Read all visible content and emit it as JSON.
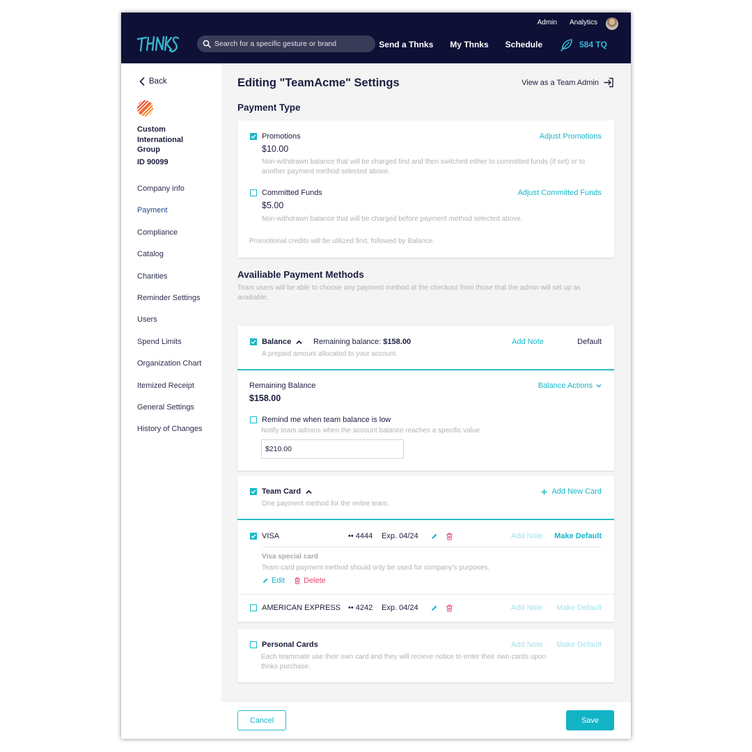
{
  "header": {
    "logo_text": "THNKS",
    "search": {
      "placeholder": "Search for a specific gesture or brand",
      "value": ""
    },
    "top_links": [
      "Admin",
      "Analytics"
    ],
    "main_nav": [
      "Send a Thnks",
      "My Thnks",
      "Schedule"
    ],
    "tq_balance": "584 TQ",
    "colors": {
      "bar": "#0e1036",
      "accent": "#38b8d0"
    }
  },
  "sidebar": {
    "back_label": "Back",
    "company_name": "Custom International Group",
    "company_id": "ID 90099",
    "items": [
      {
        "label": "Company info",
        "active": false
      },
      {
        "label": "Payment",
        "active": true
      },
      {
        "label": "Compliance",
        "active": false
      },
      {
        "label": "Catalog",
        "active": false
      },
      {
        "label": "Charities",
        "active": false
      },
      {
        "label": "Reminder Settings",
        "active": false
      },
      {
        "label": "Users",
        "active": false
      },
      {
        "label": "Spend Limits",
        "active": false
      },
      {
        "label": "Organization Chart",
        "active": false
      },
      {
        "label": "Itemized Receipt",
        "active": false
      },
      {
        "label": "General Settings",
        "active": false
      },
      {
        "label": "History of Changes",
        "active": false
      }
    ]
  },
  "main": {
    "title": "Editing \"TeamAcme\" Settings",
    "view_as_admin": "View as a Team Admin",
    "payment_type": {
      "title": "Payment Type",
      "promotions": {
        "label": "Promotions",
        "checked": true,
        "amount": "$10.00",
        "description": "Non-withdrawn balance that will be charged first and then switched either to committed funds (if set) or to another payment method selected above.",
        "action": "Adjust Promotions"
      },
      "committed": {
        "label": "Committed Funds",
        "checked": false,
        "amount": "$5.00",
        "description": "Non-withdrawn balance that will be charged before payment method selected above.",
        "action": "Adjust Committed Funds"
      },
      "note": "Promotional credits will be utilized first, followed by Balance."
    },
    "methods": {
      "title": "Availiable Payment Methods",
      "subtitle": "Team users will be able to choose any payment method at the checkout from those that the admin will set up as availiable.",
      "balance": {
        "label": "Balance",
        "checked": true,
        "remaining_label": "Remaining balance:",
        "remaining_value": "$158.00",
        "description": "A prepaid amount allocated to your account.",
        "add_note": "Add Note",
        "default_label": "Default",
        "panel": {
          "label": "Remaining Balance",
          "value": "$158.00",
          "actions": "Balance Actions",
          "remind_label": "Remind me when team balance is low",
          "remind_checked": false,
          "remind_desc": "Notify team admins when the account balance reaches a specific value",
          "threshold_value": "$210.00"
        }
      },
      "team_card": {
        "label": "Team Card",
        "checked": true,
        "description": "One payment method for the entire team.",
        "add_card": "Add New Card",
        "cards": [
          {
            "brand": "VISA",
            "checked": true,
            "last4": "•• 4444",
            "expiry": "Exp. 04/24",
            "add_note": "Add Note",
            "make_default": "Make Default",
            "note_title": "Visa special card",
            "note_text": "Team card payment method should only be used for company's purposes.",
            "edit": "Edit",
            "delete": "Delete"
          },
          {
            "brand": "AMERICAN EXPRESS",
            "checked": false,
            "last4": "•• 4242",
            "expiry": "Exp. 04/24",
            "add_note": "Add Note",
            "make_default": "Make Default"
          }
        ]
      },
      "personal": {
        "label": "Personal Cards",
        "checked": false,
        "description": "Each teammate use their own card and they will recieve notice to enter their own cards upon thnks purchase.",
        "add_note": "Add Note",
        "make_default": "Make Default"
      }
    }
  },
  "footer": {
    "cancel": "Cancel",
    "save": "Save"
  },
  "colors": {
    "teal": "#18b6c8",
    "danger": "#e9486e",
    "navy": "#1b1d3f",
    "background": "#f4f4f4"
  }
}
